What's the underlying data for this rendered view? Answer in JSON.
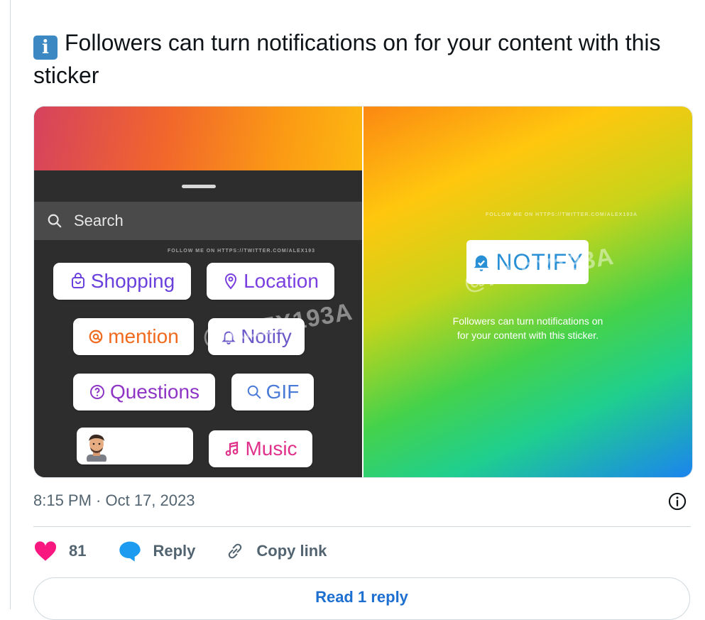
{
  "tweet": {
    "info_emoji": "i",
    "text": "Followers can turn notifications on for your content with this sticker"
  },
  "media": {
    "left_panel": {
      "search_placeholder": "Search",
      "watermark_small": "FOLLOW ME ON HTTPS://TWITTER.COM/ALEX193",
      "watermark_big": "@ALEX193A",
      "stickers": {
        "shopping": "Shopping",
        "location": "Location",
        "mention": "mention",
        "notify": "Notify",
        "questions": "Questions",
        "gif": "GIF",
        "music": "Music"
      }
    },
    "right_panel": {
      "watermark_small": "FOLLOW ME ON HTTPS://TWITTER.COM/ALEX193A",
      "watermark_big": "@ALEX193A",
      "notify_badge": "NOTIFY",
      "caption_line1": "Followers can turn notifications on",
      "caption_line2": "for your content with this sticker."
    }
  },
  "meta": {
    "timestamp": "8:15 PM · Oct 17, 2023"
  },
  "actions": {
    "like_count": "81",
    "reply_label": "Reply",
    "copy_link_label": "Copy link"
  },
  "read_replies_label": "Read 1 reply",
  "colors": {
    "like": "#f91880",
    "reply": "#1d9bf0",
    "link_blue": "#1d6fd0",
    "muted": "#536471"
  },
  "icons": [
    "info-emoji",
    "search-icon",
    "shopping-bag-icon",
    "location-pin-icon",
    "threads-icon",
    "bell-icon",
    "question-icon",
    "gif-search-icon",
    "music-note-icon",
    "info-circle-icon",
    "heart-icon",
    "reply-bubble-icon",
    "link-icon"
  ]
}
